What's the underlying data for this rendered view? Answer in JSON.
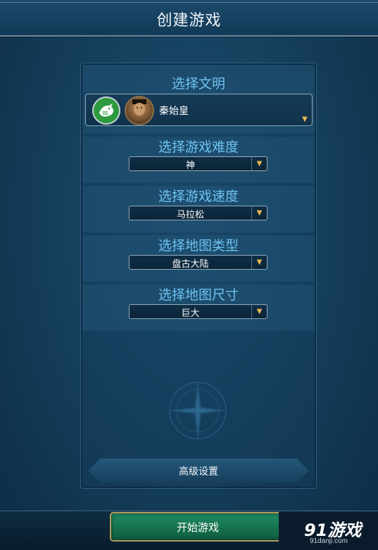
{
  "screen": {
    "title": "创建游戏"
  },
  "civilization": {
    "heading": "选择文明",
    "selected": "秦始皇",
    "emblem_icon": "dragon-emblem-icon",
    "leader_icon": "leader-portrait-icon"
  },
  "settings": [
    {
      "heading": "选择游戏难度",
      "value": "神"
    },
    {
      "heading": "选择游戏速度",
      "value": "马拉松"
    },
    {
      "heading": "选择地图类型",
      "value": "盘古大陆"
    },
    {
      "heading": "选择地图尺寸",
      "value": "巨大"
    }
  ],
  "buttons": {
    "advanced": "高级设置",
    "start": "开始游戏"
  },
  "watermark": {
    "brand": "91游戏",
    "url": "91danji.com"
  },
  "colors": {
    "heading": "#6ec2f0",
    "arrow": "#e6b94e",
    "start_button": "#1f8a62"
  }
}
